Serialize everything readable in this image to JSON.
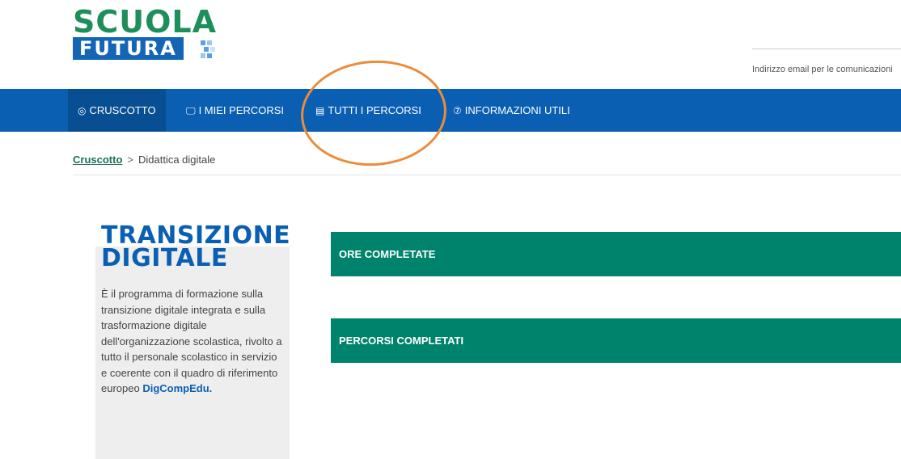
{
  "logo": {
    "line1": "SCUOLA",
    "line2": "FUTURA"
  },
  "header": {
    "email_note": "Indirizzo email per le comunicazioni"
  },
  "nav": {
    "items": [
      {
        "label": "CRUSCOTTO",
        "icon": "dashboard-icon"
      },
      {
        "label": "I MIEI PERCORSI",
        "icon": "monitor-icon"
      },
      {
        "label": "TUTTI I PERCORSI",
        "icon": "list-icon"
      },
      {
        "label": "INFORMAZIONI UTILI",
        "icon": "question-icon"
      }
    ]
  },
  "breadcrumb": {
    "home": "Cruscotto",
    "separator": ">",
    "current": "Didattica digitale"
  },
  "info": {
    "title_line1": "TRANSIZIONE",
    "title_line2": "DIGITALE",
    "description": "È il programma di formazione sulla transizione digitale integrata e sulla trasformazione digitale dell'organizzazione scolastica, rivolto a tutto il personale scolastico in servizio e coerente con il quadro di riferimento europeo",
    "highlight": "DigCompEdu."
  },
  "stats": {
    "hours_label": "ORE COMPLETATE",
    "courses_label": "PERCORSI COMPLETATI"
  },
  "colors": {
    "nav_bg": "#0a5fb3",
    "nav_active": "#084e92",
    "green_bar": "#00836c",
    "annotation": "#ec8c3a"
  }
}
